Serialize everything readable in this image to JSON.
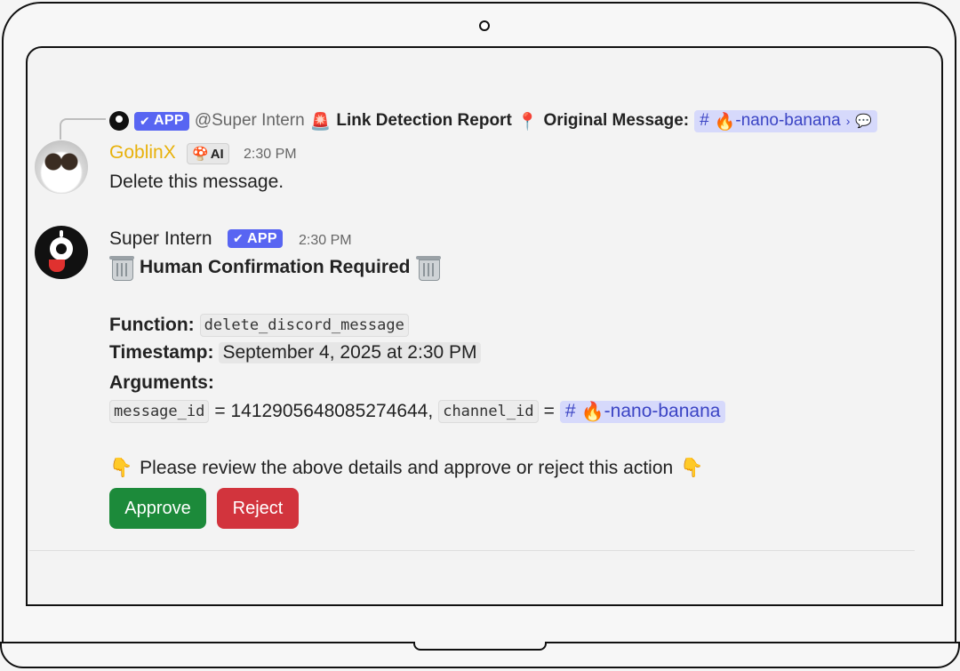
{
  "reply_header": {
    "app_badge": "APP",
    "mention": "@Super Intern",
    "report_title": "Link Detection Report",
    "original_label": "Original Message:",
    "channel": "-nano-banana",
    "siren_emoji": "🚨",
    "pin_emoji": "📍",
    "fire_emoji": "🔥",
    "hash": "#",
    "arrow": "›",
    "thread_icon": "💬"
  },
  "message1": {
    "author": "GoblinX",
    "ai_badge": "AI",
    "ai_emoji": "🍄",
    "time": "2:30 PM",
    "text": "Delete this message."
  },
  "message2": {
    "author": "Super Intern",
    "app_badge": "APP",
    "time": "2:30 PM",
    "title": "Human Confirmation Required",
    "function_label": "Function:",
    "function_value": "delete_discord_message",
    "timestamp_label": "Timestamp:",
    "timestamp_value": "September 4, 2025 at 2:30 PM",
    "arguments_label": "Arguments:",
    "arg1_key": "message_id",
    "arg1_value": "= 1412905648085274644,",
    "arg2_key": "channel_id",
    "arg2_eq": "=",
    "arg2_channel": "-nano-banana",
    "review_text": "Please review the above details and approve or reject this action",
    "point_emoji": "👇",
    "approve_label": "Approve",
    "reject_label": "Reject"
  },
  "colors": {
    "app_badge": "#5865f2",
    "goblin_name": "#e8b10a",
    "approve": "#1c8a3a",
    "reject": "#d2343d",
    "mention_bg": "#d6d9fb"
  }
}
